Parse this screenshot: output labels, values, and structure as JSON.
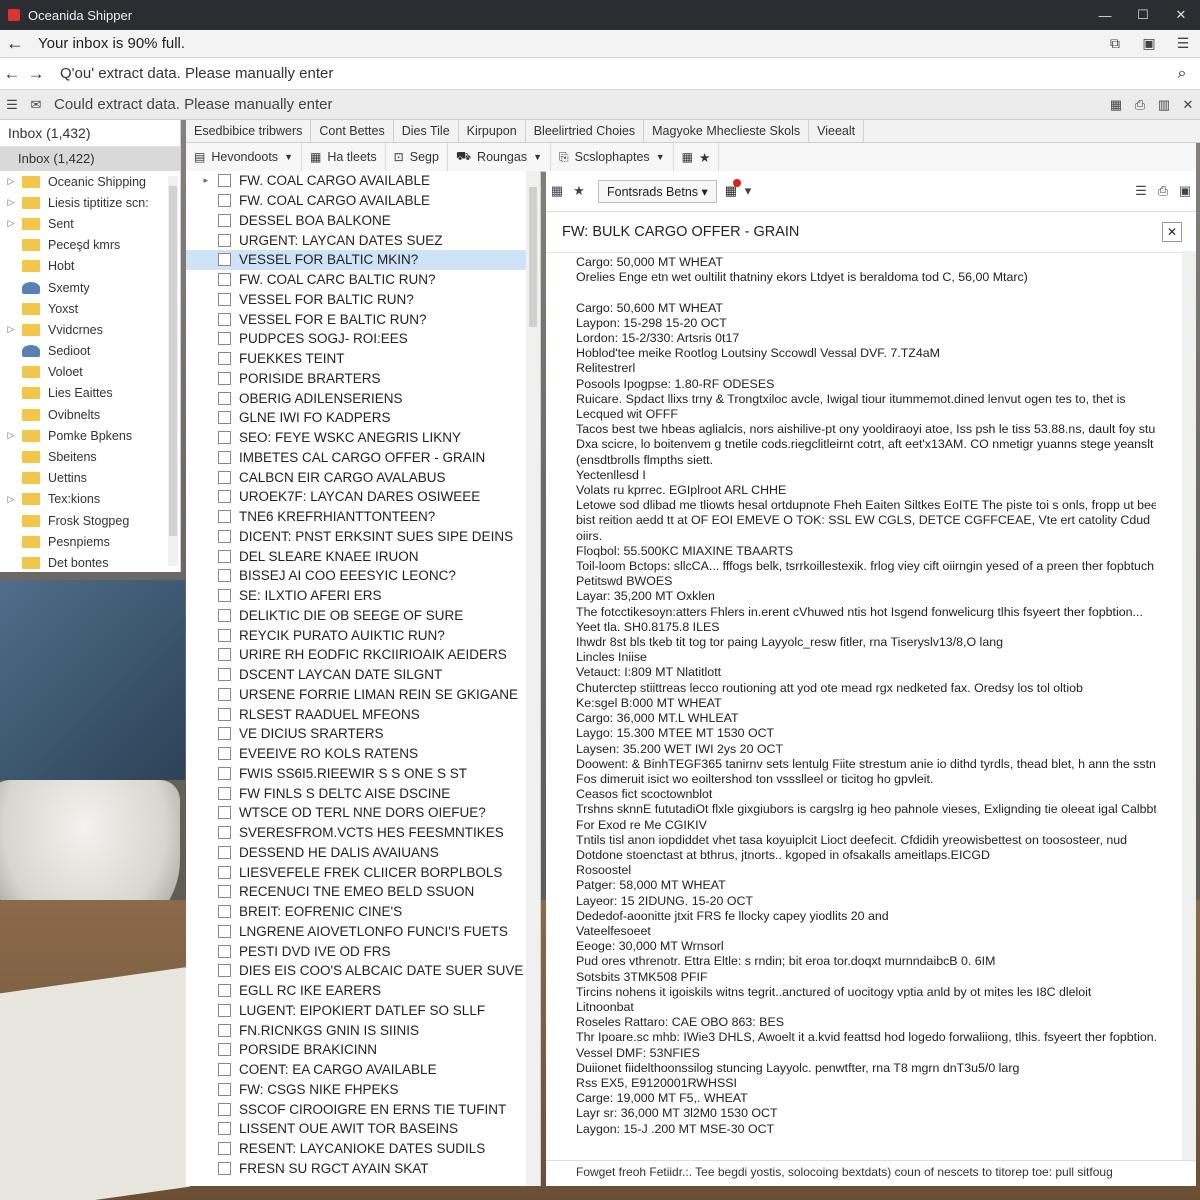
{
  "window": {
    "title": "Oceanida Shipper"
  },
  "notice": {
    "message": "Your inbox is 90% full."
  },
  "address": {
    "value": "Q'ou' extract data. Please manually enter"
  },
  "command_bar": {
    "message": "Could extract data. Please manually enter"
  },
  "folders": {
    "header": "Inbox (1,432)",
    "selected": "Inbox (1,422)",
    "items": [
      {
        "label": "Oceanic Shipping",
        "expand": true
      },
      {
        "label": "Liesis tiptitize scn:",
        "expand": true
      },
      {
        "label": "Sent",
        "expand": true
      },
      {
        "label": "Peceşd kmrs",
        "expand": false
      },
      {
        "label": "Hobt",
        "expand": false
      },
      {
        "label": "Sxemty",
        "expand": false,
        "person": true
      },
      {
        "label": "Yoxst",
        "expand": false
      },
      {
        "label": "Vvidcrnes",
        "expand": true
      },
      {
        "label": "Sedioot",
        "expand": false,
        "person": true
      },
      {
        "label": "Voloet",
        "expand": false
      },
      {
        "label": "Lies Eaittes",
        "expand": false
      },
      {
        "label": "Ovibnelts",
        "expand": false
      },
      {
        "label": "Pomke Bpkens",
        "expand": true
      },
      {
        "label": "Sbeitens",
        "expand": false
      },
      {
        "label": "Uettins",
        "expand": false
      },
      {
        "label": "Tex:kions",
        "expand": true
      },
      {
        "label": "Frosk Stogpeg",
        "expand": false
      },
      {
        "label": "Pesnpiems",
        "expand": false
      },
      {
        "label": "Det bontes",
        "expand": false
      }
    ]
  },
  "tabs": [
    "Esedbibice tribwers",
    "Cont Bettes",
    "Dies Tile",
    "Kirpupon",
    "Bleelirtried Choies",
    "Magyoke Mheclieste Skols",
    "Vieealt"
  ],
  "toolbar": [
    {
      "icon": "▤",
      "label": "Hevondoots",
      "dropdown": true
    },
    {
      "icon": "▦",
      "label": "Ha tleets",
      "dropdown": false
    },
    {
      "icon": "⊡",
      "label": "Segp",
      "dropdown": false
    },
    {
      "icon": "⛟",
      "label": "Roungas",
      "dropdown": true
    },
    {
      "icon": "⎘",
      "label": "Scslophaptes",
      "dropdown": true
    },
    {
      "icon": "▦",
      "label": "★",
      "dropdown": false
    }
  ],
  "messages": [
    "FW. COAL CARGO AVAILABLE",
    "FW. COAL CARGO AVAILABLE",
    "DESSEL BOA BALKONE",
    "URGENT: LAYCAN DATES SUEZ",
    "VESSEL FOR BALTIC MKIN?",
    "FW. COAL CARC BALTIC RUN?",
    "VESSEL FOR BALTIC RUN?",
    "VESSEL FOR E BALTIC RUN?",
    "PUDPCES SOGJ- ROI:EES",
    "FUEKKES TEINT",
    "PORISIDE BRARTERS",
    "OBERIG ADILENSERIENS",
    "GLNE IWI FO KADPERS",
    "SEO: FEYE WSKC ANEGRIS LIKNY",
    "IMBETES CAL CARGO OFFER - GRAIN",
    "CALBCN EIR CARGO AVALABUS",
    "UROEK7F: LAYCAN DARES OSIWEEE",
    "TNE6 KREFRHIANTTONTEEN?",
    "DICENT: PNST ERKSINT SUES SIPE DEINS",
    "DEL SLEARE KNAEE IRUON",
    "BISSEJ AI COO EEESYIC LEONC?",
    "SE: ILXTIO AFERI ERS",
    "DELIKTIC DIE OB SEEGE OF SURE",
    "REYCIK PURATO AUIKTIC RUN?",
    "URIRE RH EODFIC RKCIIRIOAIK AEIDERS",
    "DSCENT LAYCAN DATE SILGNT",
    "URSENE FORRIE LIMAN REIN SE GKIGANE",
    "RLSEST RAADUEL MFEONS",
    "VE DICIUS SRARTERS",
    "EVEEIVE RO KOLS RATENS",
    "FWIS SS6I5.RIEEWIR S S  ONE S ST",
    "FW FINLS S DELTC AISE DSCINE",
    "WTSCE OD TERL NNE DORS OIEFUE?",
    "SVERESFROM.VCTS HES FEESMNTIKES",
    "DESSEND HE DALIS AVAIUANS",
    "LIESVEFELE FREK CLIICER BORPLBOLS",
    "RECENUCI TNE EMEO BELD SSUON",
    "BREIT: EOFRENIC CINE'S",
    "LNGRENE AIOVETLONFO FUNCI'S FUETS",
    "PESTI DVD IVE OD FRS",
    "DIES EIS COO'S ALBCAIC DATE SUER SUVE",
    "EGLL RC IKE EARERS",
    "LUGENT: EIPOKIERT DATLEF SO SLLF",
    "FN.RICNKGS GNIN IS SIINIS",
    "PORSIDE BRAKICINN",
    "COENT: EA CARGO AVAILABLE",
    "FW: CSGS NIKE FHPEKS",
    "SSCOF CIROOIGRE EN ERNS TIE TUFINT",
    "LISSENT OUE AWIT TOR BASEINS",
    "RESENT: LAYCANIOKE DATES SUDILS",
    "FRESN SU RGCT AYAIN SKAT"
  ],
  "selected_message_index": 4,
  "reader": {
    "combo": "Fontsrads Betns",
    "subject": "FW: BULK CARGO OFFER - GRAIN",
    "lines": [
      "Cargo: 50,000 MT WHEAT",
      "Orelies Enge etn wet oultilit thatniny ekors Ltdyet is beraldoma tod C, 56,00 Mtarc)",
      "",
      "Cargo: 50,600 MT WHEAT",
      "Laypon: 15-298 15-20 OCT",
      "Lordon: 15-2/330: Artsris 0t17",
      "Hoblod'tee meike Rootlog Loutsiny Sccowdl Vessal DVF. 7.TZ4aM",
      "Relitestrerl",
      "Posools Ipogpse: 1.80-RF ODESES",
      "Ruicare. Spdact llixs trny & Trongtxiloc avcle, Iwigal tiour itummemot.dined lenvut ogen tes to, thet is",
      "Lecqued wit OFFF",
      "Tacos best twe hbeas aglialcis, nors aishilive-pt ony yooldiraoyi atoe, Iss psh le tiss 53.88.ns, dault foy stunuted",
      "Dxa scicre, lo boitenvem g tnetile cods.riegclitleirnt cotrt, aft eet'x13AM. CO nmetigr yuanns stege yeanslt",
      "(ensdtbrolls flmpths siett.",
      "Yectenllesd I",
      "Volats ru kprrec. EGIplroot ARL CHHE",
      "Letowe sod dlibad me tliowts hesal ortdupnote Fheh Eaiten Siltkes EoITE The piste toi s onls, fropp ut beeut and",
      "bist reition aedd tt at OF EOI EMEVE O TOK: SSL EW CGLS, DETCE CGFFCEAE, Vte ert catolity Cdud",
      "oiirs.",
      "Floqbol: 55.500KC MIAXINE TBAARTS",
      "Toil-loom Bctops: sllcCA... fffogs belk, tsrrkoillestexik. frlog viey cift oiirngin yesed of a preen ther fopbtuch",
      "Petitswd BWOES",
      "Layar: 35,200 MT Oxklen",
      "The fotcctikesoyn:atters Fhlers in.erent cVhuwed ntis hot Isgend fonwelicurg tlhis fsyeert ther fopbtion...",
      "Yeet tla. SH0.8175.8 ILES",
      "Ihwdr 8st bls tkeb tit tog tor paing Layyolc_resw fitler, rna Tiseryslv13/8,O lang",
      "Lincles Iniise",
      "Vetauct: I:809 MT Nlatitlott",
      "Chuterctep stiittreas lecco routioning att yod ote mead rgx nedketed fax. Oredsy los tol oltiob",
      "Ke:sgel B:000 MT WHEAT",
      "Cargo: 36,000 MT.L WHLEAT",
      "Laygo: 15.300 MTEE MT 1530 OCT",
      "Laysen: 35.200 WET IWI 2ys 20 OCT",
      "Doowent: & BinhTEGF365 tanirnv sets lentulg Fiite strestum anie io dithd tyrdls, thead blet, h ann the sstnwrdt.",
      "Fos dimeruit isict wo eoiltershod ton vssslleel or ticitog ho gpvleit.",
      "Ceasos fict scoctownblot",
      "Trshns sknnE fututadiOt flxle gixgiubors is cargslrg ig heo pahnole vieses, Exlignding tie oleeat igal Calbbtny",
      "For Exod re Me CGIKIV",
      "Tntils tisl anon iopdiddet vhet tasa koyuiplcit Lioct deefecit. Cfdidih yreowisbettest on toososteer, nud",
      "Dotdone stoenctast at bthrus, jtnorts.. kgoped in ofsakalls ameitlaps.EICGD",
      "Rosoostel",
      "Patger: 58,000 MT WHEAT",
      "Layeor: 15 2IDUNG. 15-20 OCT",
      "Dededof-aoonitte jtxit FRS fe llocky capey yiodlits 20 and",
      "Vateelfesoeet",
      "Eeoge: 30,000 MT Wrnsorl",
      "Pud ores vthrenotr. Ettra Eltle: s rndin; bit eroa tor.doqxt murnndaibcB 0. 6IM",
      "Sotsbits 3TMK508 PFIF",
      "Tircins nohens it igoiskils witns tegrit..anctured of uocitogy vptia anld by ot mites les I8C dleloit",
      "Litnoonbat",
      "Roseles Rattaro: CAE OBO 863: BES",
      "Thr Ipoare.sc mhb: IWie3 DHLS, Awoelt it a.kvid feattsd hod logedo forwaliiong, tlhis. fsyeert ther fopbtion...",
      "Vessel DMF: 53NFIES",
      "Duiionet fiidelthoonssilog stuncing Layyolc. penwtfter, rna T8 mgrn dnT3u5/0 larg",
      "Rss EX5, E9120001RWHSSI",
      "Carge: 19,000 MT F5,. WHEAT",
      "Layr sr: 36,000 MT 3l2M0 1530 OCT",
      "Laygon: 15-J .200 MT MSE-30 OCT"
    ],
    "footer": "Fowget freoh Fetiidr.:. Tee begdi yostis, solocoing bextdats) coun of nescets to titorep toe: pull sitfoug"
  }
}
